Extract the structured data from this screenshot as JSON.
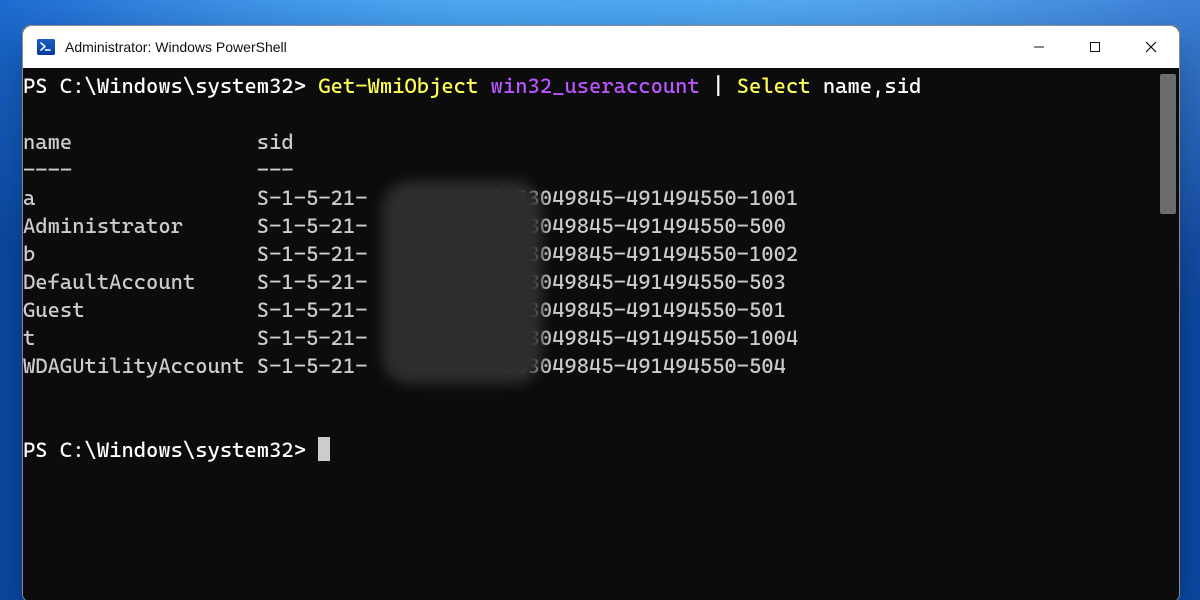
{
  "window": {
    "title": "Administrator: Windows PowerShell",
    "icon_name": "powershell-icon"
  },
  "controls": {
    "minimize": "Minimize",
    "maximize": "Maximize",
    "close": "Close"
  },
  "terminal": {
    "prompt": "PS C:\\Windows\\system32>",
    "command_tokens": {
      "cmdlet": "Get-WmiObject",
      "class": "win32_useraccount",
      "pipe": "|",
      "select": "Select",
      "props": "name,sid"
    },
    "output": {
      "headers": {
        "name": "name",
        "sid": "sid"
      },
      "header_rule": {
        "name": "----",
        "sid": "---"
      },
      "sid_prefix": "S-1-5-21-",
      "sid_mid_suffix": "-3853049845-491494550-",
      "rows": [
        {
          "name": "a",
          "rid": "1001"
        },
        {
          "name": "Administrator",
          "rid": "500"
        },
        {
          "name": "b",
          "rid": "1002"
        },
        {
          "name": "DefaultAccount",
          "rid": "503"
        },
        {
          "name": "Guest",
          "rid": "501"
        },
        {
          "name": "t",
          "rid": "1004"
        },
        {
          "name": "WDAGUtilityAccount",
          "rid": "504"
        }
      ],
      "redacted_segment_note": "One numeric segment between the S-1-5-21- prefix and -3853049845-... is blurred in the source image."
    }
  },
  "colors": {
    "terminal_bg": "#0c0c0c",
    "terminal_fg": "#cccccc",
    "cmdlet_fg": "#ffff55",
    "arg_fg": "#bb55ff",
    "titlebar_bg": "#ffffff"
  }
}
